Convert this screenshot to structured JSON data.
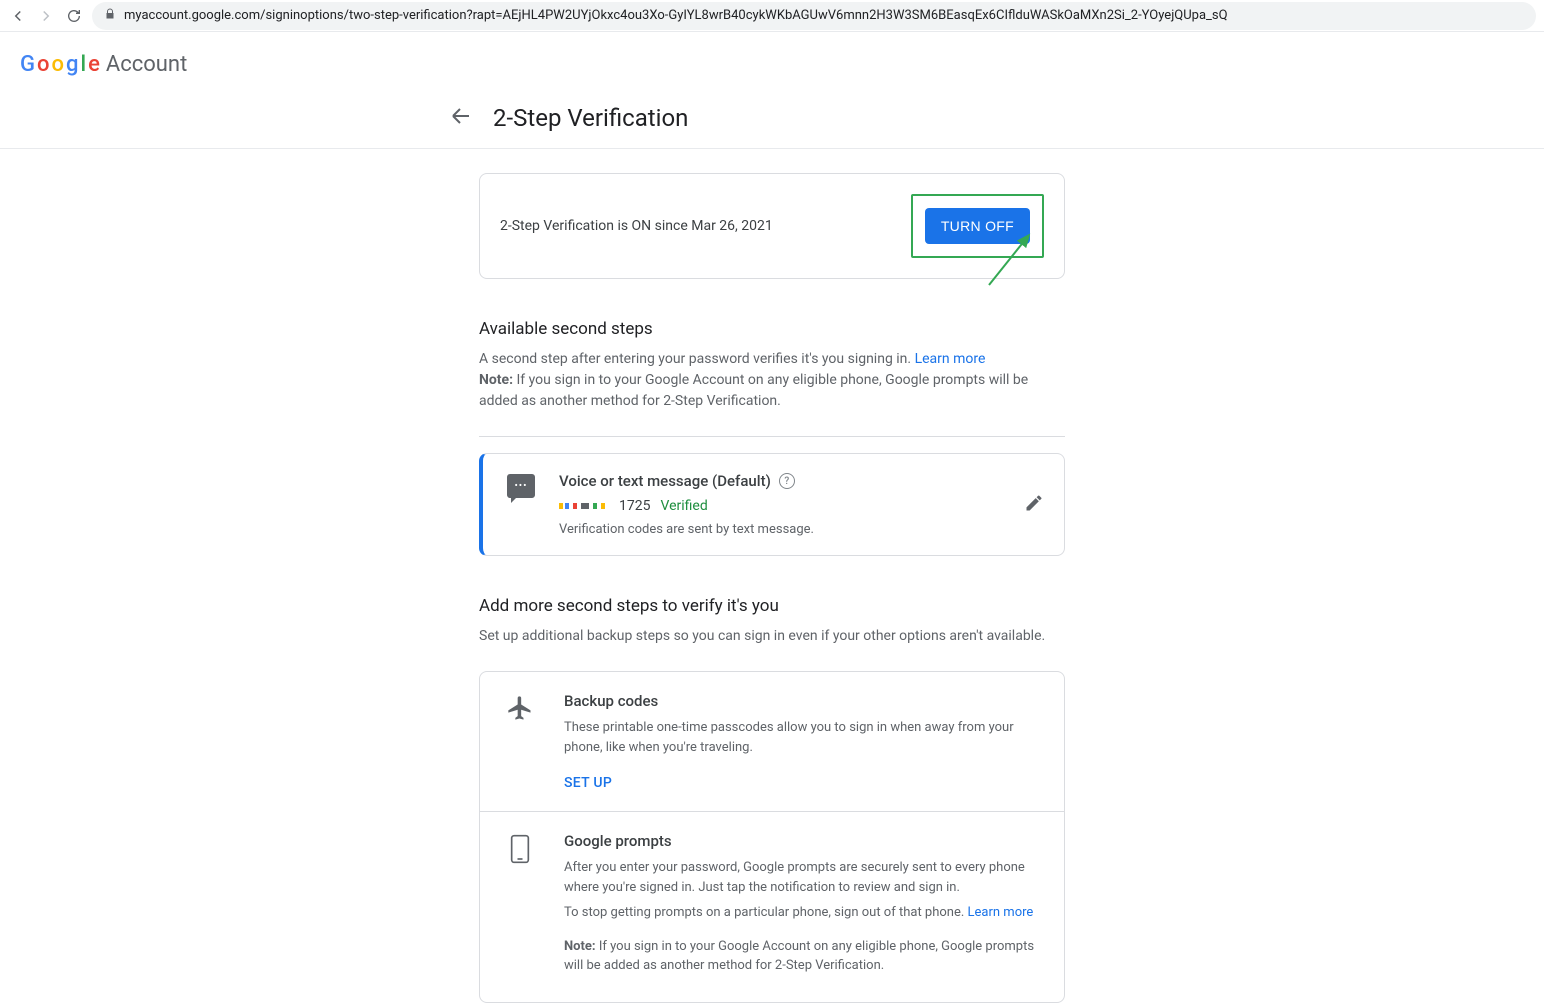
{
  "browser": {
    "url": "myaccount.google.com/signinoptions/two-step-verification?rapt=AEjHL4PW2UYjOkxc4ou3Xo-GyIYL8wrB40cykWKbAGUwV6mnn2H3W3SM6BEasqEx6CIflduWASkOaMXn2Si_2-YOyejQUpa_sQ"
  },
  "header": {
    "logo_letters": [
      "G",
      "o",
      "o",
      "g",
      "l",
      "e"
    ],
    "account_word": "Account"
  },
  "page": {
    "title": "2-Step Verification"
  },
  "status": {
    "text": "2-Step Verification is ON since Mar 26, 2021",
    "button": "TURN OFF"
  },
  "available": {
    "title": "Available second steps",
    "desc_pre": "A second step after entering your password verifies it's you signing in. ",
    "learn_more": "Learn more",
    "note_label": "Note:",
    "note_text": " If you sign in to your Google Account on any eligible phone, Google prompts will be added as another method for 2-Step Verification."
  },
  "method": {
    "title": "Voice or text message (Default)",
    "phone_last4": "1725",
    "verified": "Verified",
    "note": "Verification codes are sent by text message."
  },
  "more": {
    "title": "Add more second steps to verify it's you",
    "desc": "Set up additional backup steps so you can sign in even if your other options aren't available."
  },
  "backup": {
    "title": "Backup codes",
    "desc": "These printable one-time passcodes allow you to sign in when away from your phone, like when you're traveling.",
    "setup": "SET UP"
  },
  "prompts": {
    "title": "Google prompts",
    "desc1": "After you enter your password, Google prompts are securely sent to every phone where you're signed in. Just tap the notification to review and sign in.",
    "desc2_pre": "To stop getting prompts on a particular phone, sign out of that phone. ",
    "learn_more": "Learn more",
    "note_label": "Note:",
    "note_text": " If you sign in to your Google Account on any eligible phone, Google prompts will be added as another method for 2-Step Verification."
  }
}
